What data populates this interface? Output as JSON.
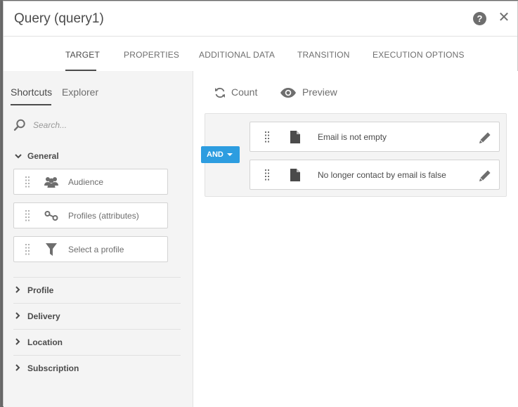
{
  "dialog": {
    "title": "Query (query1)",
    "help_label": "?",
    "close_label": "✕"
  },
  "tabs": [
    {
      "label": "TARGET",
      "active": true
    },
    {
      "label": "PROPERTIES",
      "active": false
    },
    {
      "label": "ADDITIONAL DATA",
      "active": false
    },
    {
      "label": "TRANSITION",
      "active": false
    },
    {
      "label": "EXECUTION OPTIONS",
      "active": false
    }
  ],
  "left_panel": {
    "subtabs": [
      {
        "label": "Shortcuts",
        "active": true
      },
      {
        "label": "Explorer",
        "active": false
      }
    ],
    "search": {
      "placeholder": "Search..."
    },
    "general": {
      "label": "General",
      "expanded": true,
      "items": [
        {
          "label": "Audience",
          "icon": "audience-icon"
        },
        {
          "label": "Profiles (attributes)",
          "icon": "profiles-attributes-icon"
        },
        {
          "label": "Select a profile",
          "icon": "filter-icon"
        }
      ]
    },
    "sections": [
      {
        "label": "Profile"
      },
      {
        "label": "Delivery"
      },
      {
        "label": "Location"
      },
      {
        "label": "Subscription"
      }
    ]
  },
  "right_panel": {
    "count_label": "Count",
    "preview_label": "Preview",
    "operator_label": "AND",
    "rules": [
      {
        "label": "Email is not empty"
      },
      {
        "label": "No longer contact by email is false"
      }
    ]
  },
  "colors": {
    "accent": "#2d9de0",
    "text": "#4b4b4b",
    "muted": "#6e6e6e",
    "panel_bg": "#f4f4f4"
  }
}
